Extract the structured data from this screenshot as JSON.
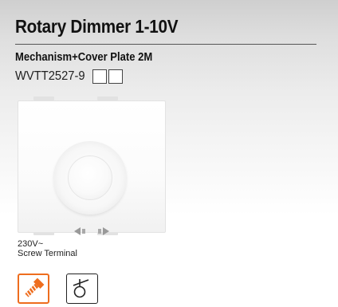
{
  "title": "Rotary Dimmer 1-10V",
  "subtitle": "Mechanism+Cover Plate 2M",
  "product_code": "WVTT2527-9",
  "product_image": {
    "control_symbol": "<>"
  },
  "specs": {
    "voltage": "230V~",
    "terminal": "Screw Terminal"
  },
  "icons": {
    "screw_terminal": "screw-terminal-icon",
    "rotary_control": "rotary-control-icon"
  },
  "colors": {
    "accent": "#ee6d1e",
    "text": "#111111",
    "rule": "#555555"
  }
}
